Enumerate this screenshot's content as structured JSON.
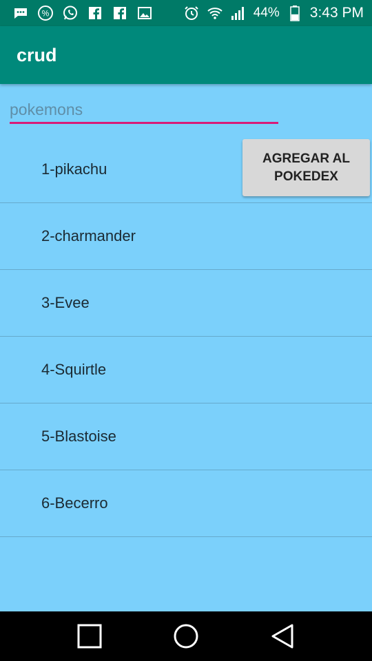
{
  "status_bar": {
    "icons_left": [
      "messages-icon",
      "discount-icon",
      "whatsapp-icon",
      "facebook-icon",
      "facebook-icon",
      "gallery-icon"
    ],
    "icons_right": [
      "alarm-icon",
      "wifi-icon",
      "signal-icon"
    ],
    "battery_percent": "44%",
    "battery_level": 0.44,
    "time": "3:43 PM"
  },
  "app_bar": {
    "title": "crud",
    "color": "#00897b"
  },
  "search": {
    "placeholder": "pokemons",
    "value": ""
  },
  "list": {
    "items": [
      {
        "label": "1-pikachu"
      },
      {
        "label": "2-charmander"
      },
      {
        "label": "3-Evee"
      },
      {
        "label": "4-Squirtle"
      },
      {
        "label": "5-Blastoise"
      },
      {
        "label": "6-Becerro"
      }
    ],
    "background": "#7bd0fb"
  },
  "add_button": {
    "label": "AGREGAR AL POKEDEX"
  },
  "nav_bar": {
    "buttons": [
      "recents-icon",
      "home-icon",
      "back-icon"
    ]
  }
}
